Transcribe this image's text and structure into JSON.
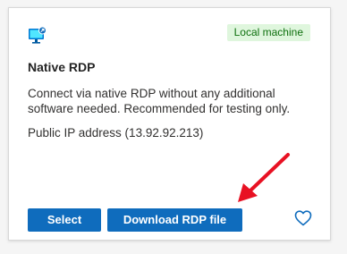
{
  "card": {
    "badge": "Local machine",
    "title": "Native RDP",
    "description": "Connect via native RDP without any additional software needed. Recommended for testing only.",
    "public_ip": "Public IP address (13.92.92.213)",
    "icon": "remote-desktop-icon"
  },
  "actions": {
    "select_label": "Select",
    "download_label": "Download RDP file",
    "favorite_icon": "heart-icon"
  },
  "annotation": {
    "arrow_color": "#e81123"
  },
  "colors": {
    "primary_button": "#0f6cbd",
    "badge_bg": "#dff6dd",
    "badge_text": "#0e700e"
  }
}
